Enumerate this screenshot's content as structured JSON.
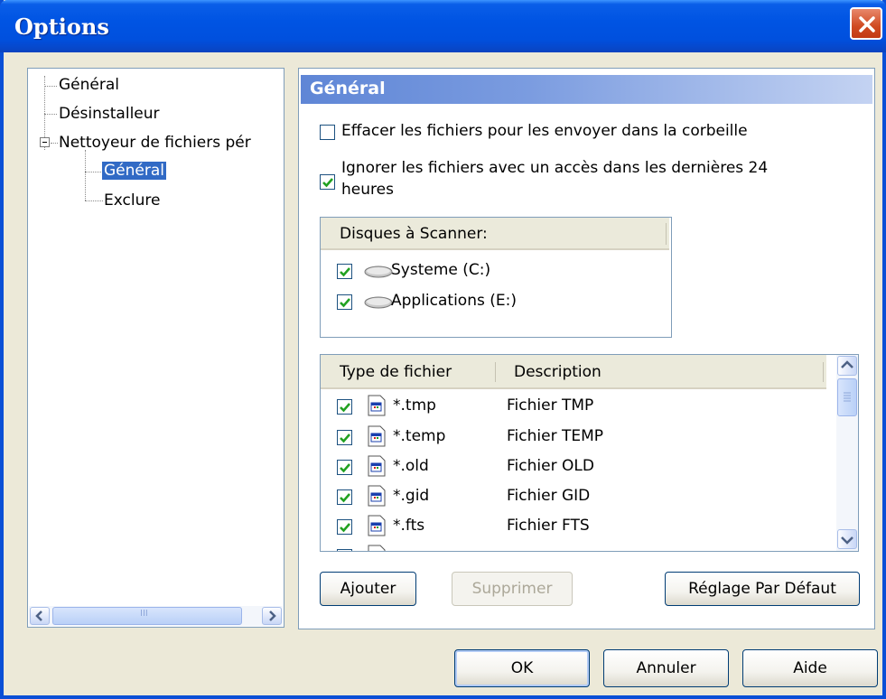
{
  "window": {
    "title": "Options"
  },
  "tree": {
    "items": [
      {
        "label": "Général"
      },
      {
        "label": "Désinstalleur"
      },
      {
        "label": "Nettoyeur de fichiers pér"
      },
      {
        "label": "Général"
      },
      {
        "label": "Exclure"
      }
    ],
    "scroll_grip": "III"
  },
  "panel": {
    "header": "Général",
    "option1": {
      "label": "Effacer les fichiers pour les envoyer dans la corbeille",
      "checked": false
    },
    "option2": {
      "label_line1": "Ignorer les fichiers avec un accès dans les dernières 24",
      "label_line2": "heures",
      "checked": true
    },
    "drives": {
      "header": "Disques à Scanner:",
      "items": [
        {
          "label": "Systeme (C:)",
          "checked": true,
          "icon": "drive-icon"
        },
        {
          "label": "Applications (E:)",
          "checked": true,
          "icon": "drive-icon"
        }
      ]
    },
    "file_types": {
      "columns": [
        "Type de fichier",
        "Description"
      ],
      "rows": [
        {
          "type": "*.tmp",
          "description": "Fichier TMP",
          "checked": true
        },
        {
          "type": "*.temp",
          "description": "Fichier TEMP",
          "checked": true
        },
        {
          "type": "*.old",
          "description": "Fichier OLD",
          "checked": true
        },
        {
          "type": "*.gid",
          "description": "Fichier GID",
          "checked": true
        },
        {
          "type": "*.fts",
          "description": "Fichier FTS",
          "checked": true
        }
      ]
    },
    "buttons": {
      "add": "Ajouter",
      "remove": "Supprimer",
      "defaults": "Réglage Par Défaut"
    }
  },
  "footer": {
    "ok": "OK",
    "cancel": "Annuler",
    "help": "Aide"
  },
  "colors": {
    "titlebar": "#0054e3",
    "selection": "#316ac5",
    "check": "#21a121",
    "close": "#d04a22"
  }
}
